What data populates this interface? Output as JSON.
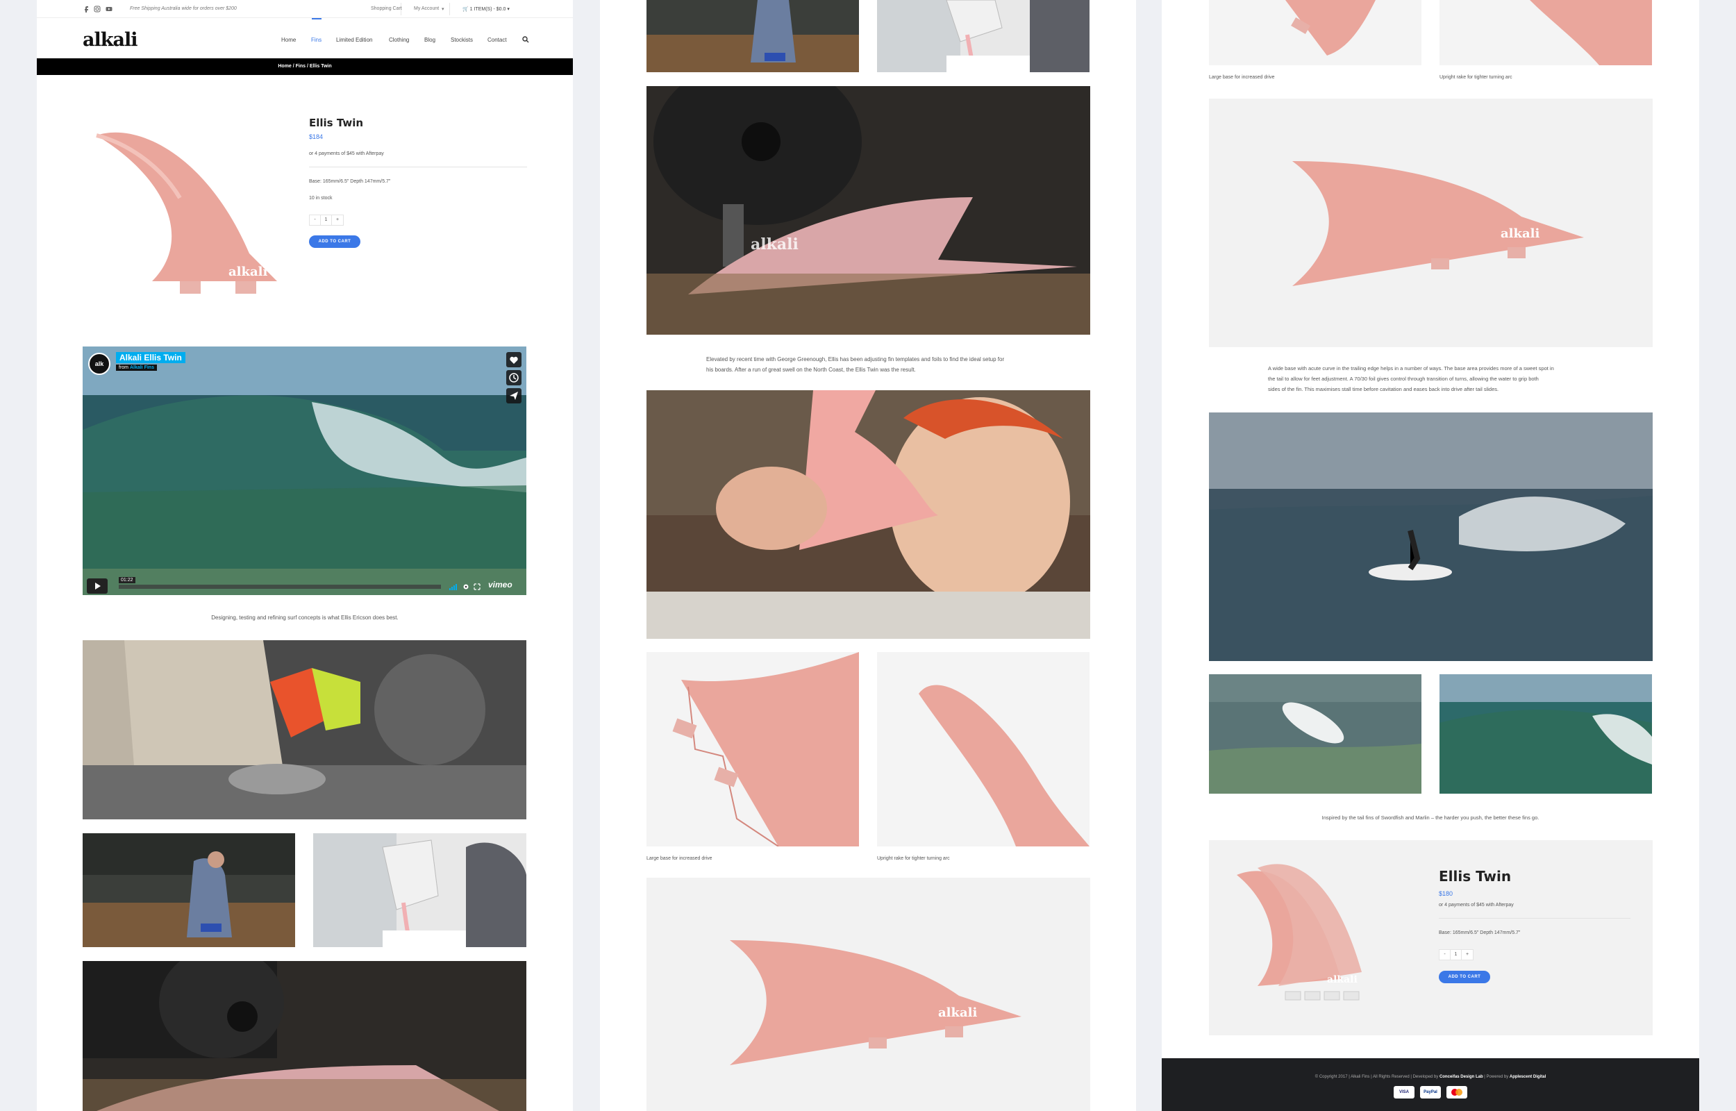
{
  "topbar": {
    "shipping": "Free Shipping Australia wide for orders over $200",
    "shopping_cart": "Shopping Cart",
    "my_account": "My Account",
    "cart_summary": "1 ITEM(S) - $0.0"
  },
  "brand": {
    "logo": "alkali"
  },
  "nav": [
    "Home",
    "Fins",
    "Limited Edition",
    "Clothing",
    "Blog",
    "Stockists",
    "Contact"
  ],
  "breadcrumb": "Home / Fins / Ellis Twin",
  "product": {
    "title": "Ellis Twin",
    "price": "$184",
    "afterpay": "or 4 payments of $45 with Afterpay",
    "dimensions": "Base: 165mm/6.5\" Depth 147mm/5.7\"",
    "stock": "10 in stock",
    "qty_minus": "-",
    "qty_value": "1",
    "qty_plus": "+",
    "add_to_cart": "ADD TO CART"
  },
  "video": {
    "title": "Alkali Ellis Twin",
    "from_label": "from",
    "from_channel": "Alkali Fins",
    "badge": "alk",
    "time": "01:22",
    "brand": "vimeo"
  },
  "captions": {
    "video": "Designing, testing and refining surf concepts is what Ellis Ericson does best.",
    "elevated_line1": "Elevated by recent time with George Greenough, Ellis has been adjusting fin templates and foils to find the ideal setup for",
    "elevated_line2": "his boards. After a run of great swell on the North Coast, the Ellis Twin was the result.",
    "large_base": "Large base for increased drive",
    "upright_rake": "Upright rake for tighter turning arc",
    "wide_base_1": "A wide base with acute curve in the trailing edge helps in a number of ways. The base area provides more of a sweet spot in",
    "wide_base_2": "the tail to allow for feet adjustment. A 70/30 foil gives control through transition of turns, allowing the water to grip both",
    "wide_base_3": "sides of the fin. This maximises stall time before cavitation and eases back into drive after tail slides.",
    "inspired": "Inspired by the tail fins of Swordfish and Marlin – the harder you push, the better these fins go."
  },
  "product_bottom": {
    "title": "Ellis Twin",
    "price": "$180",
    "afterpay": "or 4 payments of $45 with Afterpay",
    "dimensions": "Base: 165mm/6.5\" Depth 147mm/5.7\"",
    "qty_minus": "-",
    "qty_value": "1",
    "qty_plus": "+",
    "add_to_cart": "ADD TO CART"
  },
  "footer": {
    "copyright": "© Copyright 2017  |  Alkali Fins  |  All Rights Reserved  |  Developed by",
    "developer": "Conceifas Design Lab",
    "powered_label": "|  Powered by",
    "powered": "Applescent Digital",
    "payments": [
      "VISA",
      "PayPal",
      "MC"
    ]
  },
  "colors": {
    "accent": "#3b78e7",
    "fin_pink": "#eaa69c",
    "footer_bg": "#1e1f22"
  }
}
